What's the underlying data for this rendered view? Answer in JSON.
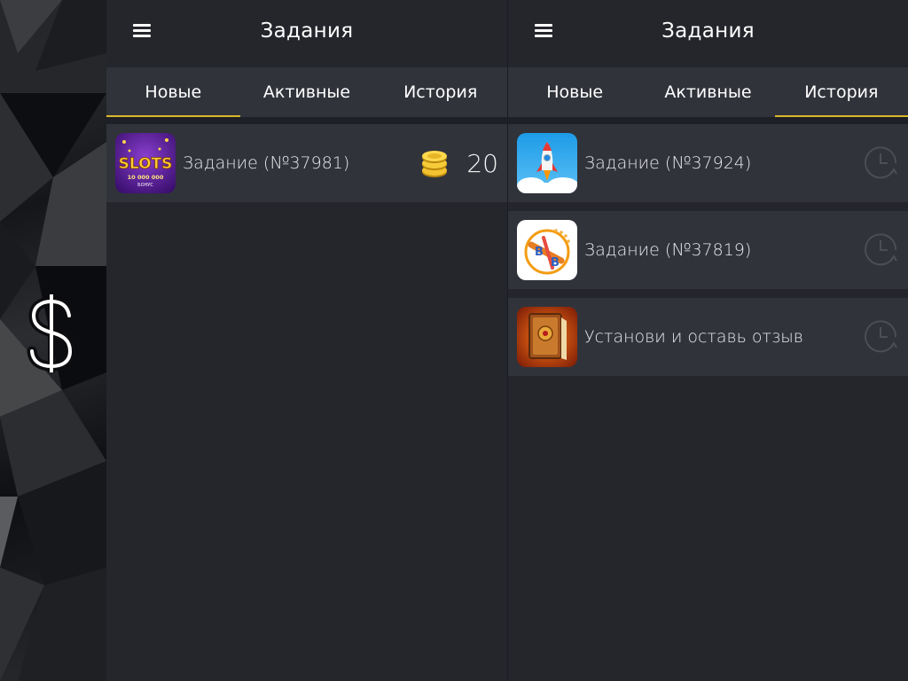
{
  "left_panel": {
    "title": "Задания",
    "tabs": [
      {
        "label": "Новые",
        "active": true
      },
      {
        "label": "Активные",
        "active": false
      },
      {
        "label": "История",
        "active": false
      }
    ],
    "tasks": [
      {
        "label": "Задание (№37981)",
        "icon": "slots-app-icon",
        "reward": "20",
        "reward_icon": "coins-icon"
      }
    ]
  },
  "right_panel": {
    "title": "Задания",
    "tabs": [
      {
        "label": "Новые",
        "active": false
      },
      {
        "label": "Активные",
        "active": false
      },
      {
        "label": "История",
        "active": true
      }
    ],
    "tasks": [
      {
        "label": "Задание (№37924)",
        "icon": "rocket-app-icon",
        "status_icon": "clock-icon"
      },
      {
        "label": "Задание (№37819)",
        "icon": "travel-app-icon",
        "status_icon": "clock-icon"
      },
      {
        "label": "Установи и оставь отзыв",
        "icon": "book-app-icon",
        "status_icon": "clock-icon"
      }
    ]
  },
  "sidebar": {
    "icon": "dollar-icon"
  },
  "colors": {
    "background": "#24262c",
    "tab_bar": "#31333b",
    "row": "#31333b",
    "accent": "#d9b82a"
  }
}
